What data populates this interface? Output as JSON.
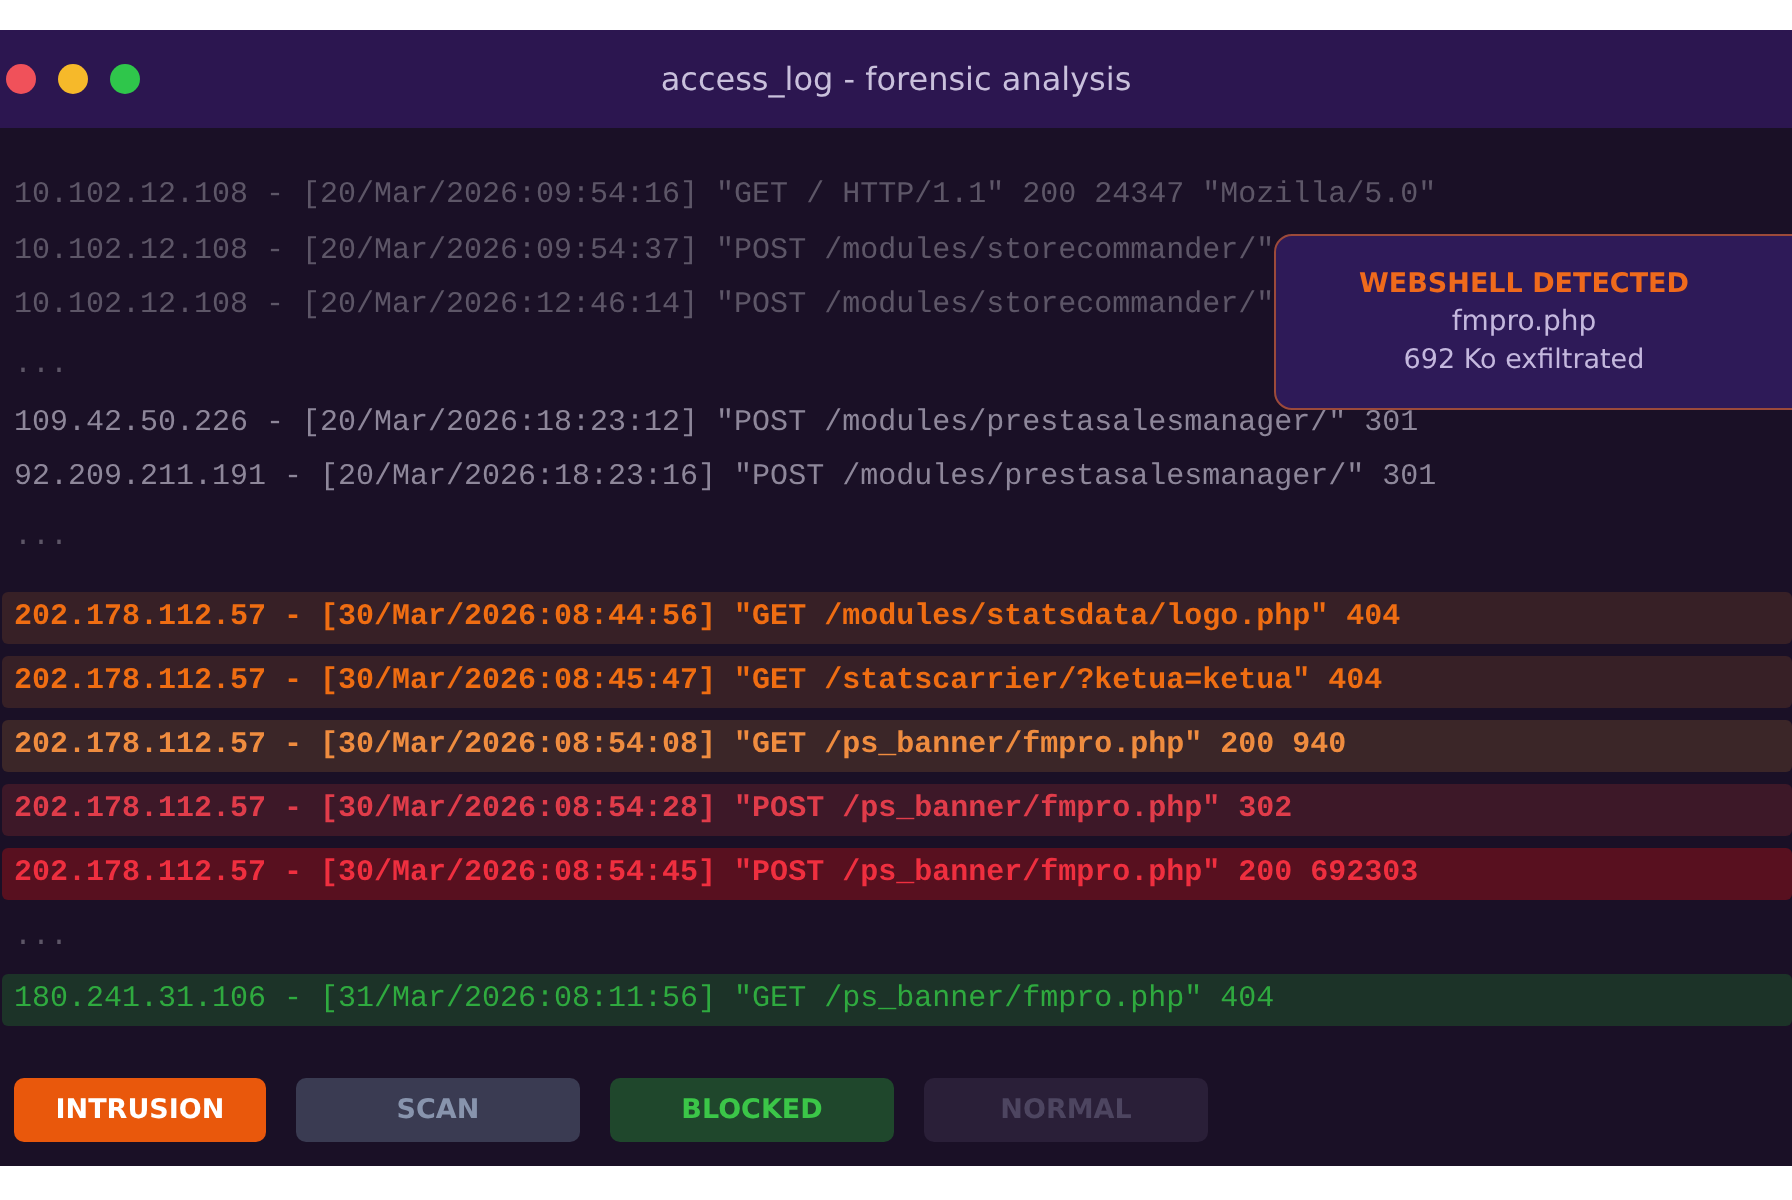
{
  "window": {
    "title": "access_log - forensic analysis"
  },
  "log_lines": [
    {
      "kind": "faint",
      "text": "10.102.12.108 - [20/Mar/2026:09:54:16] \"GET / HTTP/1.1\" 200 24347 \"Mozilla/5.0\""
    },
    {
      "kind": "faint",
      "text": "10.102.12.108 - [20/Mar/2026:09:54:37] \"POST /modules/storecommander/\""
    },
    {
      "kind": "faint",
      "text": "10.102.12.108 - [20/Mar/2026:12:46:14] \"POST /modules/storecommander/\""
    },
    {
      "kind": "gap",
      "text": "..."
    },
    {
      "kind": "plain",
      "text": "109.42.50.226 - [20/Mar/2026:18:23:12] \"POST /modules/prestasalesmanager/\" 301"
    },
    {
      "kind": "plain",
      "text": "92.209.211.191 - [20/Mar/2026:18:23:16] \"POST /modules/prestasalesmanager/\" 301"
    },
    {
      "kind": "gap",
      "text": "..."
    },
    {
      "kind": "probe",
      "text": "202.178.112.57 - [30/Mar/2026:08:44:56] \"GET /modules/statsdata/logo.php\" 404"
    },
    {
      "kind": "probe",
      "text": "202.178.112.57 - [30/Mar/2026:08:45:47] \"GET /statscarrier/?ketua=ketua\" 404"
    },
    {
      "kind": "access",
      "text": "202.178.112.57 - [30/Mar/2026:08:54:08] \"GET /ps_banner/fmpro.php\" 200 940"
    },
    {
      "kind": "exploit",
      "text": "202.178.112.57 - [30/Mar/2026:08:54:28] \"POST /ps_banner/fmpro.php\" 302"
    },
    {
      "kind": "exfil",
      "text": "202.178.112.57 - [30/Mar/2026:08:54:45] \"POST /ps_banner/fmpro.php\" 200 692303"
    },
    {
      "kind": "gap",
      "text": "..."
    },
    {
      "kind": "blocked",
      "text": "180.241.31.106 - [31/Mar/2026:08:11:56] \"GET /ps_banner/fmpro.php\" 404"
    }
  ],
  "alert": {
    "title": "WEBSHELL DETECTED",
    "file": "fmpro.php",
    "detail": "692 Ko exfiltrated"
  },
  "legend": [
    {
      "kind": "intrusion",
      "label": "INTRUSION"
    },
    {
      "kind": "scan",
      "label": "SCAN"
    },
    {
      "kind": "blocked",
      "label": "BLOCKED"
    },
    {
      "kind": "normal",
      "label": "NORMAL"
    }
  ]
}
